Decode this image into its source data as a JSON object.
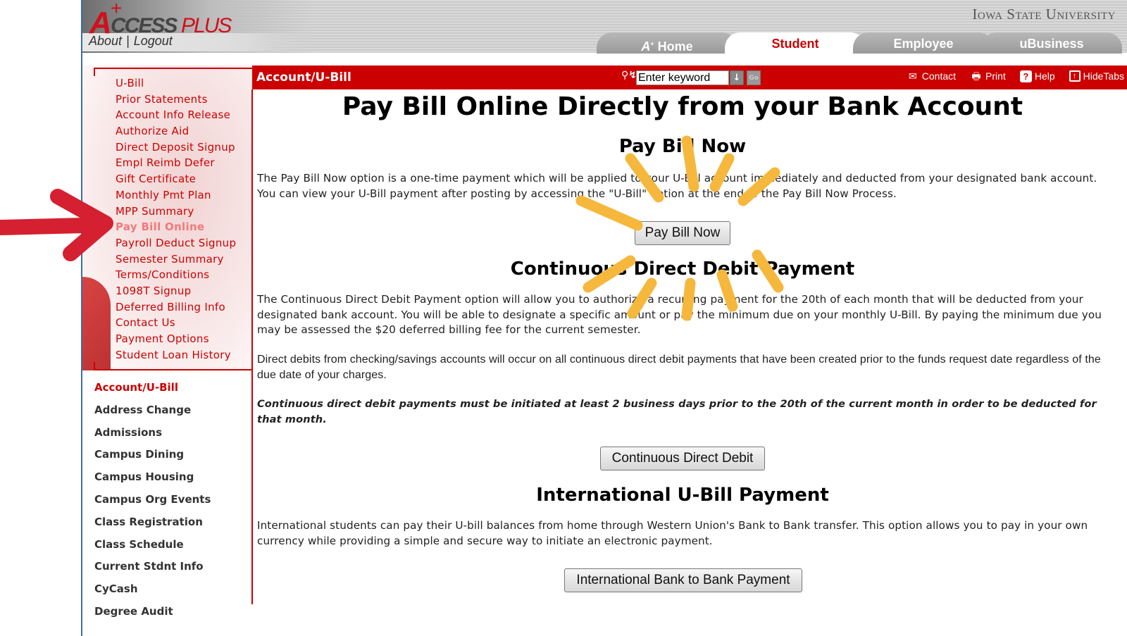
{
  "header": {
    "logo_letter": "A",
    "logo_plus": "+",
    "logo_ccess": "CCESS",
    "logo_plus_word": "PLUS",
    "about_label": "About",
    "separator": "|",
    "logout_label": "Logout",
    "university": "Iowa State University",
    "tabs": [
      {
        "label": "Home",
        "prefix": "A",
        "active": false
      },
      {
        "label": "Student",
        "active": true
      },
      {
        "label": "Employee",
        "active": false
      },
      {
        "label": "uBusiness",
        "active": false
      }
    ]
  },
  "titlebar": {
    "title": "Account/U-Bill",
    "key_icon": "key-icon",
    "search_placeholder": "Enter keyword",
    "search_value": "Enter keyword",
    "dropdown_glyph": "↓",
    "go_label": "Go",
    "actions": [
      {
        "label": "Contact",
        "icon": "envelope-icon",
        "glyph": "✉"
      },
      {
        "label": "Print",
        "icon": "printer-icon",
        "glyph": "🖶"
      },
      {
        "label": "Help",
        "icon": "help-icon",
        "glyph": "?"
      },
      {
        "label": "HideTabs",
        "icon": "hide-tabs-icon",
        "glyph": "↑"
      }
    ]
  },
  "sidebar": {
    "sub_items": [
      {
        "label": "U-Bill",
        "active": false
      },
      {
        "label": "Prior Statements",
        "active": false
      },
      {
        "label": "Account Info Release",
        "active": false
      },
      {
        "label": "Authorize Aid",
        "active": false
      },
      {
        "label": "Direct Deposit Signup",
        "active": false
      },
      {
        "label": "Empl Reimb Defer",
        "active": false
      },
      {
        "label": "Gift Certificate",
        "active": false
      },
      {
        "label": "Monthly Pmt Plan",
        "active": false
      },
      {
        "label": "MPP Summary",
        "active": false
      },
      {
        "label": "Pay Bill Online",
        "active": true
      },
      {
        "label": "Payroll Deduct Signup",
        "active": false
      },
      {
        "label": "Semester Summary",
        "active": false
      },
      {
        "label": "Terms/Conditions",
        "active": false
      },
      {
        "label": "1098T Signup",
        "active": false
      },
      {
        "label": "Deferred Billing Info",
        "active": false
      },
      {
        "label": "Contact Us",
        "active": false
      },
      {
        "label": "Payment Options",
        "active": false
      },
      {
        "label": "Student Loan History",
        "active": false
      }
    ],
    "main_items": [
      {
        "label": "Account/U-Bill",
        "active": true
      },
      {
        "label": "Address Change",
        "active": false
      },
      {
        "label": "Admissions",
        "active": false
      },
      {
        "label": "Campus Dining",
        "active": false
      },
      {
        "label": "Campus Housing",
        "active": false
      },
      {
        "label": "Campus Org Events",
        "active": false
      },
      {
        "label": "Class Registration",
        "active": false
      },
      {
        "label": "Class Schedule",
        "active": false
      },
      {
        "label": "Current Stdnt Info",
        "active": false
      },
      {
        "label": "CyCash",
        "active": false
      },
      {
        "label": "Degree Audit",
        "active": false
      }
    ]
  },
  "content": {
    "page_title": "Pay Bill Online Directly from your Bank Account",
    "pay_now": {
      "heading": "Pay Bill Now",
      "text": "The Pay Bill Now option is a one-time payment which will be applied to your U-Bill account immediately and deducted from your designated bank account. You can view your U-Bill payment after posting by accessing the \"U-Bill\" option at the end of the Pay Bill Now Process.",
      "button": "Pay Bill Now"
    },
    "continuous": {
      "heading": "Continuous Direct Debit Payment",
      "text": "The Continuous Direct Debit Payment option will allow you to authorize a recurring payment for the 20th of each month that will be deducted from your designated bank account. You will be able to designate a specific amount or pay the minimum due on your monthly U-Bill. By paying the minimum due you may be assessed the $20 deferred billing fee for the current semester.",
      "text2": "Direct debits from checking/savings accounts will occur on all continuous direct debit payments that have been created prior to the funds request date regardless of the due date of your charges.",
      "warning": "Continuous direct debit payments must be initiated at least 2 business days prior to the 20th of the current month in order to be deducted for that month.",
      "button": "Continuous Direct Debit"
    },
    "international": {
      "heading": "International U-Bill Payment",
      "text": "International students can pay their U-bill balances from home through Western Union's Bank to Bank transfer. This option allows you to pay in your own currency while providing a simple and secure way to initiate an electronic payment.",
      "button": "International Bank to Bank Payment"
    }
  },
  "annotations": {
    "arrow_color": "#d42030",
    "sunburst_color": "#f5b83d"
  },
  "colors": {
    "brand_red": "#cc0000",
    "active_sub_item": "#f07a7a",
    "nav_text": "#333333"
  }
}
